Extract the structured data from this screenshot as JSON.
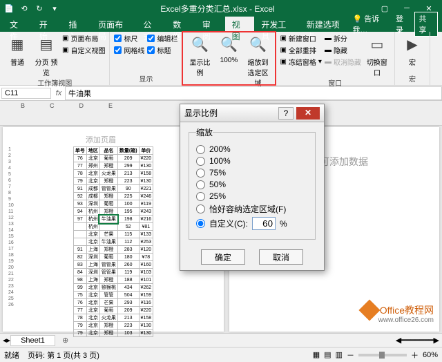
{
  "app": {
    "title": "Excel多重分类汇总.xlsx - Excel"
  },
  "qat": [
    "⟲",
    "↻"
  ],
  "winctl": [
    "▢",
    "─",
    "✕"
  ],
  "tabs": {
    "items": [
      "文件",
      "开始",
      "插入",
      "页面布局",
      "公式",
      "数据",
      "审阅",
      "视图",
      "开发工具",
      "新建选项卡"
    ],
    "active": "视图",
    "tell": "告诉我…",
    "signin": "登录",
    "share": "共享"
  },
  "ribbon": {
    "g1": {
      "btn1": "普通",
      "btn2": "分页\n预览",
      "btn3": "页面布局",
      "btn4": "自定义视图",
      "label": "工作簿视图"
    },
    "g2": {
      "c1": "标尺",
      "c2": "编辑栏",
      "c3": "网格线",
      "c4": "标题",
      "label": "显示"
    },
    "g3": {
      "zoom": "显示比例",
      "p100": "100%",
      "tosel": "缩放到\n选定区域",
      "label": "显示比例"
    },
    "g4": {
      "r1": "新建窗口",
      "r2": "全部重排",
      "r3": "冻结窗格",
      "s1": "拆分",
      "s2": "隐藏",
      "s3": "取消隐藏",
      "switch": "切换窗口",
      "label": "窗口"
    },
    "g5": {
      "macro": "宏",
      "label": "宏"
    }
  },
  "fbar": {
    "name": "C11",
    "value": "牛油果"
  },
  "colHeaders": [
    "B",
    "C",
    "D",
    "E"
  ],
  "addHeader": "添加页眉",
  "addData": "单击可添加数据",
  "tableHeaders": [
    "单号",
    "地区",
    "品名",
    "数量(箱)",
    "单价"
  ],
  "rows": [
    [
      "76",
      "北京",
      "葡萄",
      "209",
      "¥220"
    ],
    [
      "77",
      "郑州",
      "郑橙",
      "299",
      "¥130"
    ],
    [
      "78",
      "北京",
      "火龙果",
      "213",
      "¥158"
    ],
    [
      "79",
      "北京",
      "郑橙",
      "223",
      "¥130"
    ],
    [
      "91",
      "成都",
      "管管果",
      "90",
      "¥221"
    ],
    [
      "92",
      "成都",
      "郑橙",
      "225",
      "¥246"
    ],
    [
      "93",
      "深圳",
      "葡萄",
      "100",
      "¥119"
    ],
    [
      "94",
      "杭州",
      "郑橙",
      "195",
      "¥243"
    ],
    [
      "97",
      "杭州",
      "牛油果",
      "198",
      "¥216"
    ],
    [
      "",
      "杭州",
      "",
      "52",
      "¥81"
    ],
    [
      "",
      "北京",
      "芒果",
      "115",
      "¥133"
    ],
    [
      "",
      "北京",
      "牛油果",
      "112",
      "¥253"
    ],
    [
      "91",
      "上海",
      "郑橙",
      "283",
      "¥120"
    ],
    [
      "82",
      "深圳",
      "葡萄",
      "180",
      "¥78"
    ],
    [
      "83",
      "上海",
      "管管果",
      "260",
      "¥160"
    ],
    [
      "84",
      "深圳",
      "管管果",
      "119",
      "¥103"
    ],
    [
      "98",
      "上海",
      "郑橙",
      "188",
      "¥101"
    ],
    [
      "99",
      "北京",
      "猕猴桃",
      "434",
      "¥262"
    ],
    [
      "75",
      "北京",
      "管管",
      "504",
      "¥159"
    ],
    [
      "76",
      "北京",
      "芒果",
      "293",
      "¥116"
    ],
    [
      "77",
      "北京",
      "葡萄",
      "209",
      "¥220"
    ],
    [
      "78",
      "北京",
      "火龙果",
      "213",
      "¥158"
    ],
    [
      "79",
      "北京",
      "郑橙",
      "223",
      "¥130"
    ],
    [
      "79",
      "北京",
      "郑橙",
      "103",
      "¥130"
    ]
  ],
  "dialog": {
    "title": "显示比例",
    "legend": "缩放",
    "opts": [
      "200%",
      "100%",
      "75%",
      "50%",
      "25%"
    ],
    "fit": "恰好容纳选定区域(F)",
    "customLabel": "自定义(C):",
    "customValue": "60",
    "pct": "%",
    "ok": "确定",
    "cancel": "取消",
    "help": "?",
    "close": "✕"
  },
  "sheet": {
    "name": "Sheet1",
    "plus": "⊕"
  },
  "status": {
    "ready": "就绪",
    "page": "页码: 第 1 页(共 3 页)",
    "zoom": "60%"
  },
  "watermark": {
    "text": "Office教程网",
    "url": "www.office26.com"
  }
}
